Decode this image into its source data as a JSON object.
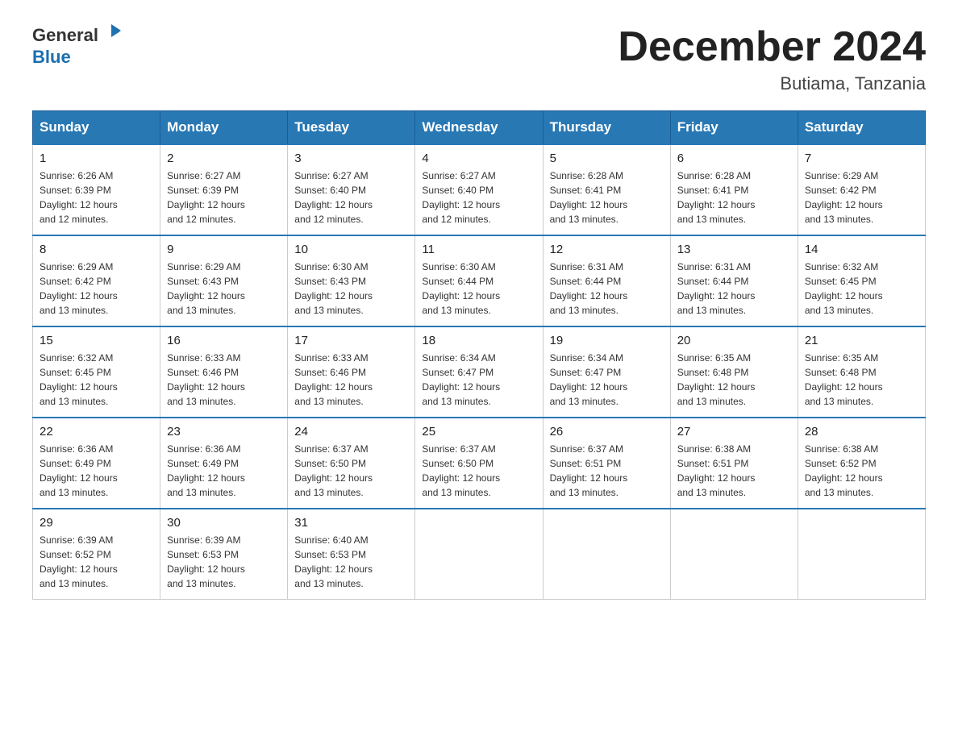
{
  "header": {
    "logo_general": "General",
    "logo_blue": "Blue",
    "month_title": "December 2024",
    "location": "Butiama, Tanzania"
  },
  "days_of_week": [
    "Sunday",
    "Monday",
    "Tuesday",
    "Wednesday",
    "Thursday",
    "Friday",
    "Saturday"
  ],
  "weeks": [
    [
      {
        "day": "1",
        "sunrise": "6:26 AM",
        "sunset": "6:39 PM",
        "daylight": "12 hours and 12 minutes."
      },
      {
        "day": "2",
        "sunrise": "6:27 AM",
        "sunset": "6:39 PM",
        "daylight": "12 hours and 12 minutes."
      },
      {
        "day": "3",
        "sunrise": "6:27 AM",
        "sunset": "6:40 PM",
        "daylight": "12 hours and 12 minutes."
      },
      {
        "day": "4",
        "sunrise": "6:27 AM",
        "sunset": "6:40 PM",
        "daylight": "12 hours and 12 minutes."
      },
      {
        "day": "5",
        "sunrise": "6:28 AM",
        "sunset": "6:41 PM",
        "daylight": "12 hours and 13 minutes."
      },
      {
        "day": "6",
        "sunrise": "6:28 AM",
        "sunset": "6:41 PM",
        "daylight": "12 hours and 13 minutes."
      },
      {
        "day": "7",
        "sunrise": "6:29 AM",
        "sunset": "6:42 PM",
        "daylight": "12 hours and 13 minutes."
      }
    ],
    [
      {
        "day": "8",
        "sunrise": "6:29 AM",
        "sunset": "6:42 PM",
        "daylight": "12 hours and 13 minutes."
      },
      {
        "day": "9",
        "sunrise": "6:29 AM",
        "sunset": "6:43 PM",
        "daylight": "12 hours and 13 minutes."
      },
      {
        "day": "10",
        "sunrise": "6:30 AM",
        "sunset": "6:43 PM",
        "daylight": "12 hours and 13 minutes."
      },
      {
        "day": "11",
        "sunrise": "6:30 AM",
        "sunset": "6:44 PM",
        "daylight": "12 hours and 13 minutes."
      },
      {
        "day": "12",
        "sunrise": "6:31 AM",
        "sunset": "6:44 PM",
        "daylight": "12 hours and 13 minutes."
      },
      {
        "day": "13",
        "sunrise": "6:31 AM",
        "sunset": "6:44 PM",
        "daylight": "12 hours and 13 minutes."
      },
      {
        "day": "14",
        "sunrise": "6:32 AM",
        "sunset": "6:45 PM",
        "daylight": "12 hours and 13 minutes."
      }
    ],
    [
      {
        "day": "15",
        "sunrise": "6:32 AM",
        "sunset": "6:45 PM",
        "daylight": "12 hours and 13 minutes."
      },
      {
        "day": "16",
        "sunrise": "6:33 AM",
        "sunset": "6:46 PM",
        "daylight": "12 hours and 13 minutes."
      },
      {
        "day": "17",
        "sunrise": "6:33 AM",
        "sunset": "6:46 PM",
        "daylight": "12 hours and 13 minutes."
      },
      {
        "day": "18",
        "sunrise": "6:34 AM",
        "sunset": "6:47 PM",
        "daylight": "12 hours and 13 minutes."
      },
      {
        "day": "19",
        "sunrise": "6:34 AM",
        "sunset": "6:47 PM",
        "daylight": "12 hours and 13 minutes."
      },
      {
        "day": "20",
        "sunrise": "6:35 AM",
        "sunset": "6:48 PM",
        "daylight": "12 hours and 13 minutes."
      },
      {
        "day": "21",
        "sunrise": "6:35 AM",
        "sunset": "6:48 PM",
        "daylight": "12 hours and 13 minutes."
      }
    ],
    [
      {
        "day": "22",
        "sunrise": "6:36 AM",
        "sunset": "6:49 PM",
        "daylight": "12 hours and 13 minutes."
      },
      {
        "day": "23",
        "sunrise": "6:36 AM",
        "sunset": "6:49 PM",
        "daylight": "12 hours and 13 minutes."
      },
      {
        "day": "24",
        "sunrise": "6:37 AM",
        "sunset": "6:50 PM",
        "daylight": "12 hours and 13 minutes."
      },
      {
        "day": "25",
        "sunrise": "6:37 AM",
        "sunset": "6:50 PM",
        "daylight": "12 hours and 13 minutes."
      },
      {
        "day": "26",
        "sunrise": "6:37 AM",
        "sunset": "6:51 PM",
        "daylight": "12 hours and 13 minutes."
      },
      {
        "day": "27",
        "sunrise": "6:38 AM",
        "sunset": "6:51 PM",
        "daylight": "12 hours and 13 minutes."
      },
      {
        "day": "28",
        "sunrise": "6:38 AM",
        "sunset": "6:52 PM",
        "daylight": "12 hours and 13 minutes."
      }
    ],
    [
      {
        "day": "29",
        "sunrise": "6:39 AM",
        "sunset": "6:52 PM",
        "daylight": "12 hours and 13 minutes."
      },
      {
        "day": "30",
        "sunrise": "6:39 AM",
        "sunset": "6:53 PM",
        "daylight": "12 hours and 13 minutes."
      },
      {
        "day": "31",
        "sunrise": "6:40 AM",
        "sunset": "6:53 PM",
        "daylight": "12 hours and 13 minutes."
      },
      null,
      null,
      null,
      null
    ]
  ],
  "labels": {
    "sunrise": "Sunrise:",
    "sunset": "Sunset:",
    "daylight": "Daylight: 12 hours"
  }
}
